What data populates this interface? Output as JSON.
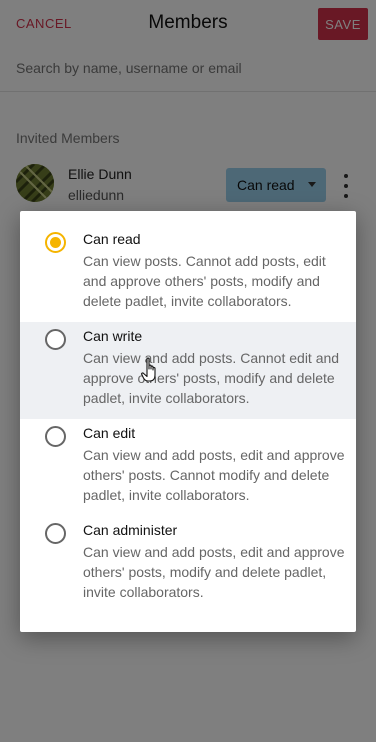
{
  "header": {
    "cancel_label": "CANCEL",
    "title": "Members",
    "save_label": "SAVE"
  },
  "search": {
    "placeholder": "Search by name, username or email"
  },
  "invited_section": {
    "label": "Invited Members"
  },
  "member": {
    "name": "Ellie Dunn",
    "username": "elliedunn",
    "role_label": "Can read"
  },
  "permission_dialog": {
    "selected_index": 0,
    "hovered_index": 1,
    "options": [
      {
        "title": "Can read",
        "description": "Can view posts. Cannot add posts, edit and approve others' posts, modify and delete padlet, invite collaborators."
      },
      {
        "title": "Can write",
        "description": "Can view and add posts. Cannot edit and approve others' posts, modify and delete padlet, invite collaborators."
      },
      {
        "title": "Can edit",
        "description": "Can view and add posts, edit and approve others' posts. Cannot modify and delete padlet, invite collaborators."
      },
      {
        "title": "Can administer",
        "description": "Can view and add posts, edit and approve others' posts, modify and delete padlet, invite collaborators."
      }
    ]
  },
  "colors": {
    "accent_red": "#d3314a",
    "radio_selected": "#f5b400",
    "role_button_bg": "#9ad0ec",
    "overlay": "rgba(0,0,0,0.5)"
  },
  "icons": {
    "more": "vertical-dots-icon",
    "caret": "caret-down-icon",
    "cursor": "hand-pointer-cursor-icon"
  }
}
